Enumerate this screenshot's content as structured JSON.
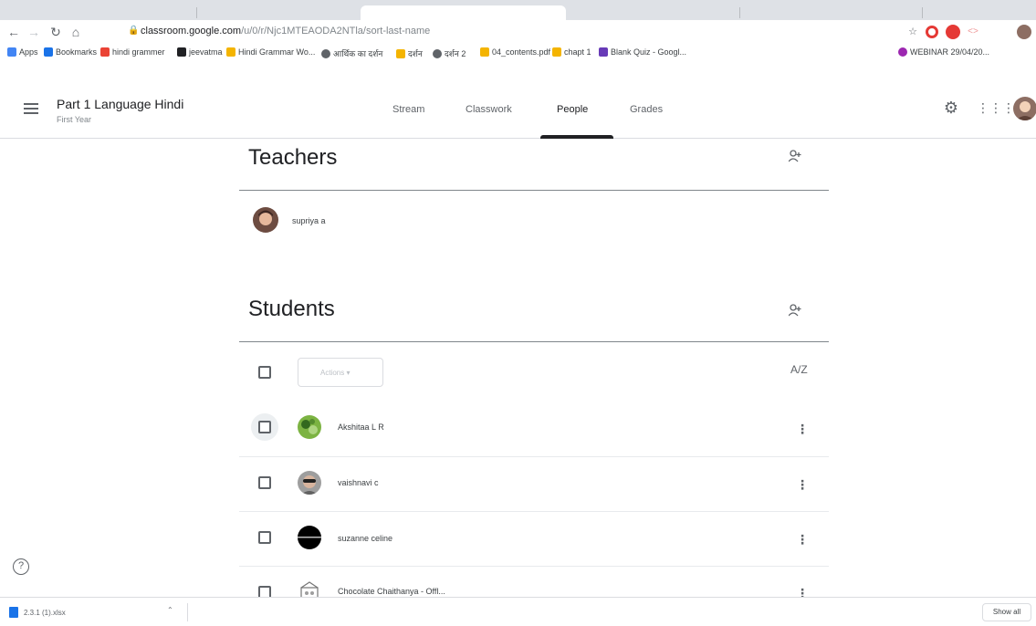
{
  "browser": {
    "url_host": "classroom.google.com",
    "url_path": "/u/0/r/Njc1MTEAODA2NTla/sort-last-name",
    "bookmarks": [
      {
        "label": "Apps",
        "color": "#4285f4"
      },
      {
        "label": "Bookmarks",
        "color": "#1a73e8"
      },
      {
        "label": "hindi grammer",
        "color": "#ea4335"
      },
      {
        "label": "jeevatma",
        "color": "#202124"
      },
      {
        "label": "Hindi Grammar Wo...",
        "color": "#f4b400"
      },
      {
        "label": "आर्थिक का दर्शन",
        "color": "#5f6368"
      },
      {
        "label": "दर्शन",
        "color": "#f4b400"
      },
      {
        "label": "दर्शन 2",
        "color": "#5f6368"
      },
      {
        "label": "04_contents.pdf",
        "color": "#f4b400"
      },
      {
        "label": "chapt 1",
        "color": "#f4b400"
      },
      {
        "label": "Blank Quiz - Googl...",
        "color": "#673ab7"
      },
      {
        "label": "WEBINAR 29/04/20...",
        "color": "#9c27b0"
      }
    ]
  },
  "classroom": {
    "class_title": "Part 1 Language Hindi",
    "class_subtitle": "First Year",
    "tabs": [
      "Stream",
      "Classwork",
      "People",
      "Grades"
    ],
    "active_tab": "People"
  },
  "teachers": {
    "title": "Teachers",
    "list": [
      {
        "name": "supriya a"
      }
    ]
  },
  "students": {
    "title": "Students",
    "actions_label": "Actions",
    "sort_label": "A/Z",
    "list": [
      {
        "name": "Akshitaa L R",
        "avatar": "green"
      },
      {
        "name": "vaishnavi c",
        "avatar": "photo"
      },
      {
        "name": "suzanne celine",
        "avatar": "dark"
      },
      {
        "name": "Chocolate Chaithanya - Offl...",
        "avatar": "graphic"
      }
    ]
  },
  "downloads": {
    "file": "2.3.1 (1).xlsx",
    "show_all": "Show all"
  }
}
